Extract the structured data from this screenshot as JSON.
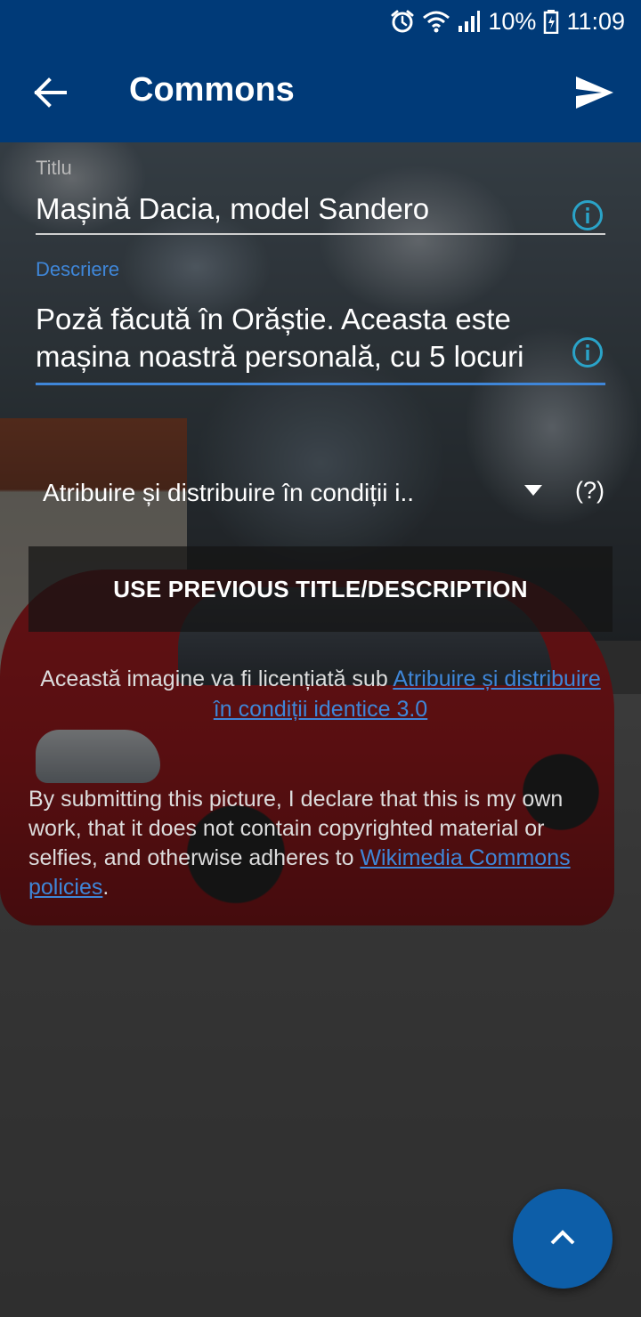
{
  "status_bar": {
    "battery_percent": "10%",
    "time": "11:09",
    "icons": [
      "alarm-icon",
      "wifi-icon",
      "signal-icon",
      "battery-icon"
    ]
  },
  "app_bar": {
    "title": "Commons",
    "back_icon": "arrow-back-icon",
    "send_icon": "send-icon",
    "color": "#003a78"
  },
  "form": {
    "title_label": "Titlu",
    "title_value": "Mașină Dacia, model Sandero",
    "description_label": "Descriere",
    "description_value": "Poză făcută în Orăștie. Aceasta este mașina noastră personală, cu 5 locuri",
    "info_icon": "info-icon",
    "accent_color": "#3f86d8"
  },
  "license": {
    "selected": "Atribuire și distribuire în condiții i..",
    "help": "(?)"
  },
  "buttons": {
    "use_previous": "USE PREVIOUS TITLE/DESCRIPTION"
  },
  "license_note": {
    "prefix": "Această imagine va fi licențiată sub ",
    "link": "Atribuire și distribuire în condiții identice 3.0"
  },
  "declaration": {
    "text": "By submitting this picture, I declare that this is my own work, that it does not contain copyrighted material or selfies, and otherwise adheres to ",
    "link": "Wikimedia Commons policies",
    "suffix": "."
  },
  "fab": {
    "icon": "chevron-up-icon",
    "color": "#0d5ea8"
  }
}
